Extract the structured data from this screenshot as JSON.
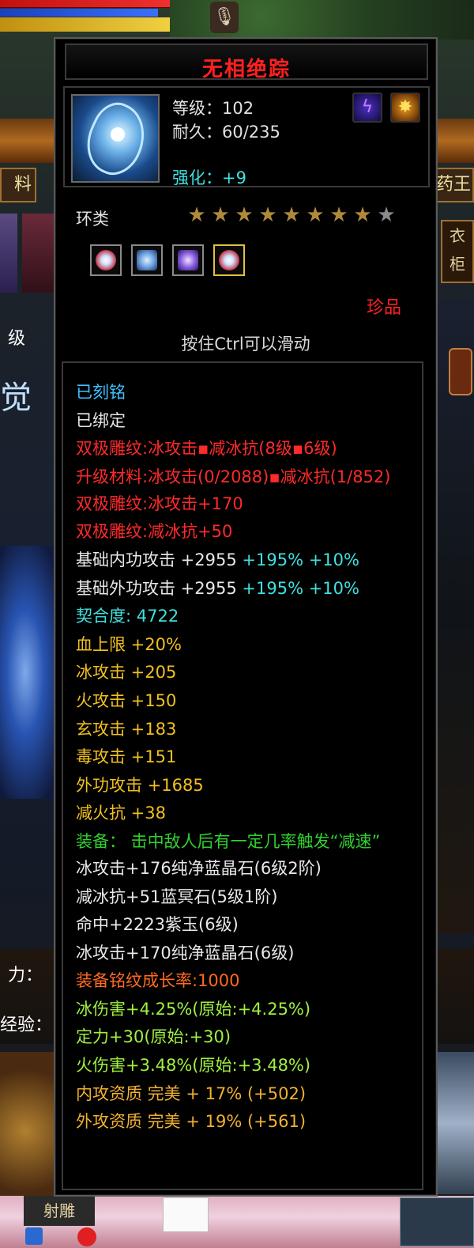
{
  "item": {
    "name": "无相绝踪",
    "level_label": "等级：102",
    "durability_label": "耐久：60/235",
    "enhance_label": "强化：+9",
    "category": "环类",
    "stars_total": 9,
    "stars_filled": 8,
    "rarity": "珍品",
    "scroll_hint": "按住Ctrl可以滑动"
  },
  "attributes": [
    {
      "text": "已刻铭",
      "color": "cyan"
    },
    {
      "text": "已绑定",
      "color": "white"
    },
    {
      "text": "双极雕纹:冰攻击▪减冰抗(8级▪6级)",
      "color": "red"
    },
    {
      "text": "升级材料:冰攻击(0/2088)▪减冰抗(1/852)",
      "color": "red",
      "wrap": true
    },
    {
      "text": "双极雕纹:冰攻击+170",
      "color": "red"
    },
    {
      "text": "双极雕纹:减冰抗+50",
      "color": "red"
    },
    {
      "text": "基础内功攻击 +2955",
      "extra": " +195% +10%",
      "color": "white"
    },
    {
      "text": "基础外功攻击 +2955",
      "extra": " +195% +10%",
      "color": "white"
    },
    {
      "text": "契合度: 4722",
      "color": "teal"
    },
    {
      "text": "血上限 +20%",
      "color": "yellow"
    },
    {
      "text": "冰攻击 +205",
      "color": "yellow"
    },
    {
      "text": "火攻击 +150",
      "color": "yellow"
    },
    {
      "text": "玄攻击 +183",
      "color": "yellow"
    },
    {
      "text": "毒攻击 +151",
      "color": "yellow"
    },
    {
      "text": "外功攻击 +1685",
      "color": "yellow"
    },
    {
      "text": "减火抗 +38",
      "color": "yellow"
    },
    {
      "text": "装备： 击中敌人后有一定几率触发“减速”",
      "color": "green",
      "wrap": true
    },
    {
      "text": "冰攻击+176纯净蓝晶石(6级2阶)",
      "color": "white"
    },
    {
      "text": "减冰抗+51蓝冥石(5级1阶)",
      "color": "white"
    },
    {
      "text": "命中+2223紫玉(6级)",
      "color": "white"
    },
    {
      "text": "冰攻击+170纯净蓝晶石(6级)",
      "color": "white"
    },
    {
      "text": "装备铭纹成长率:1000",
      "color": "orange"
    },
    {
      "text": "冰伤害+4.25%(原始:+4.25%)",
      "color": "lime"
    },
    {
      "text": "定力+30(原始:+30)",
      "color": "lime"
    },
    {
      "text": "火伤害+3.48%(原始:+3.48%)",
      "color": "lime"
    },
    {
      "text": "内攻资质 完美 + 17% (+502)",
      "color": "gold"
    },
    {
      "text": "外攻资质 完美 + 19% (+561)",
      "color": "gold"
    }
  ],
  "background": {
    "tab_left": "料",
    "tab_right": "药王",
    "side_button": "衣柜",
    "level_text": "级",
    "power_text": "力：",
    "exp_text": "经验：",
    "logo_text": "觉",
    "taskbar_app": "射雕"
  },
  "colors": {
    "title": "#ff2020",
    "rarity": "#ff2020",
    "enhance": "#40e0e0"
  }
}
